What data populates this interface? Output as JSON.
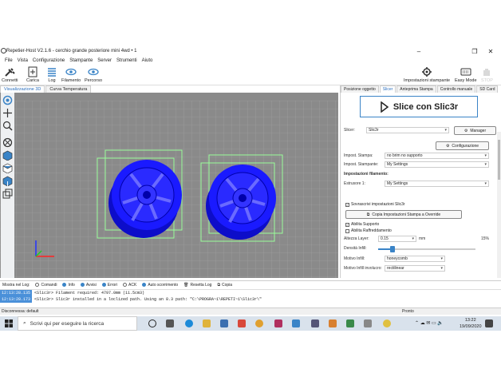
{
  "window": {
    "title": "Repetier-Host V2.1.6 - cerchio grande posteriore mini 4wd • 1",
    "minimize": "–",
    "maximize": "❐",
    "close": "✕"
  },
  "menu": [
    "File",
    "Vista",
    "Configurazione",
    "Stampante",
    "Server",
    "Strumenti",
    "Aiuto"
  ],
  "toolbar": {
    "connect": "Connetti",
    "load": "Carica",
    "log": "Log",
    "filament": "Filamento",
    "path": "Percorso",
    "printer_settings": "Impostazioni stampante",
    "easy_mode": "Easy Mode",
    "stop": "STOP"
  },
  "left_tabs": [
    "Visualizzazione 3D",
    "Curva Temperatura"
  ],
  "right_tabs": [
    "Posizione oggetto",
    "Slicer",
    "Anteprima Stampa",
    "Controllo manuale",
    "SD Card"
  ],
  "slicer": {
    "slice_button": "Slice con Slic3r",
    "slicer_label": "Slicer:",
    "slicer_value": "Slic3r",
    "manager_button": "Manager",
    "config_button": "Configurazione",
    "print_settings_label": "Impost. Stampa:",
    "print_settings_value": "no brim no supporto",
    "printer_settings_label": "Impost. Stampante:",
    "printer_settings_value": "My Settings",
    "filament_header": "Impostazioni filamento:",
    "extruder_label": "Estrusore 1:",
    "extruder_value": "My Settings",
    "override_label": "Sovrascrivi impostazioni Slic3r",
    "copy_button": "Copia Impostazioni Stampa a Override",
    "support_label": "Abilita Supporto",
    "cooling_label": "Abilita Raffreddamento",
    "layer_label": "Altezza Layer:",
    "layer_value": "0.15",
    "layer_unit": "mm",
    "infill_percent": "15%",
    "infill_density_label": "Densità Infill:",
    "infill_density": 0.15,
    "infill_pattern_label": "Motivo Infill:",
    "infill_pattern_value": "honeycomb",
    "shell_pattern_label": "Motivo Infill involucro:",
    "shell_pattern_value": "rectilinear"
  },
  "logbar": {
    "show_in_log": "Mostra nel Log:",
    "filters": [
      {
        "label": "Comandi",
        "color": "#ffffff"
      },
      {
        "label": "Info",
        "color": "#3a84c7"
      },
      {
        "label": "Avvisi",
        "color": "#3a84c7"
      },
      {
        "label": "Errori",
        "color": "#3a84c7"
      },
      {
        "label": "ACK",
        "color": "#ffffff"
      },
      {
        "label": "Auto scorrimento",
        "color": "#3a84c7"
      }
    ],
    "reset": "Resetta Log",
    "copy": "Copia"
  },
  "log_lines": [
    {
      "time": "12:13:28.135",
      "text": "<Slic3r> Filament required: 4797.0mm (11.5cm3)"
    },
    {
      "time": "12:13:28.173",
      "text": "<Slic3r> Slic3r installed in a loclized path. Using an 8.3 path: \"C:\\PROGRA~1\\REPETI~1\\Slic3r\\\""
    }
  ],
  "status": {
    "left": "Disconnessa: default",
    "right": "Pronto"
  },
  "taskbar": {
    "search_placeholder": "Scrivi qui per eseguire la ricerca",
    "time": "13:22",
    "date": "19/09/2020"
  },
  "colors": {
    "part": "#1a1aff",
    "bbox": "#9aff9a",
    "accent": "#3a84c7"
  }
}
